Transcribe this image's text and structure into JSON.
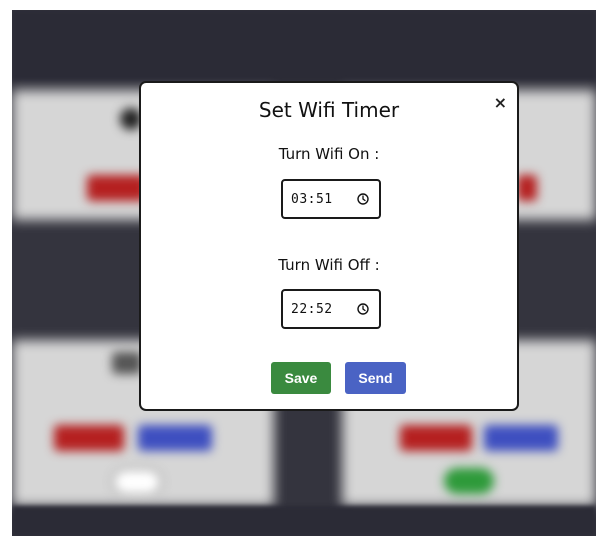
{
  "modal": {
    "title": "Set Wifi Timer",
    "close_symbol": "×",
    "on_label": "Turn Wifi On :",
    "on_time": "03:51",
    "off_label": "Turn Wifi Off :",
    "off_time": "22:52",
    "save_label": "Save",
    "send_label": "Send"
  },
  "icons": {
    "time_picker": "clock-icon",
    "close": "close-icon"
  },
  "colors": {
    "save": "#3a8a3f",
    "send": "#4a63c4",
    "backdrop": "#34343e",
    "card_off_red": "#b52020",
    "card_blue": "#3e4fc0",
    "toggle_on": "#2e9a3a"
  },
  "background": {
    "toggle_left_on": false,
    "toggle_right_on": true
  }
}
